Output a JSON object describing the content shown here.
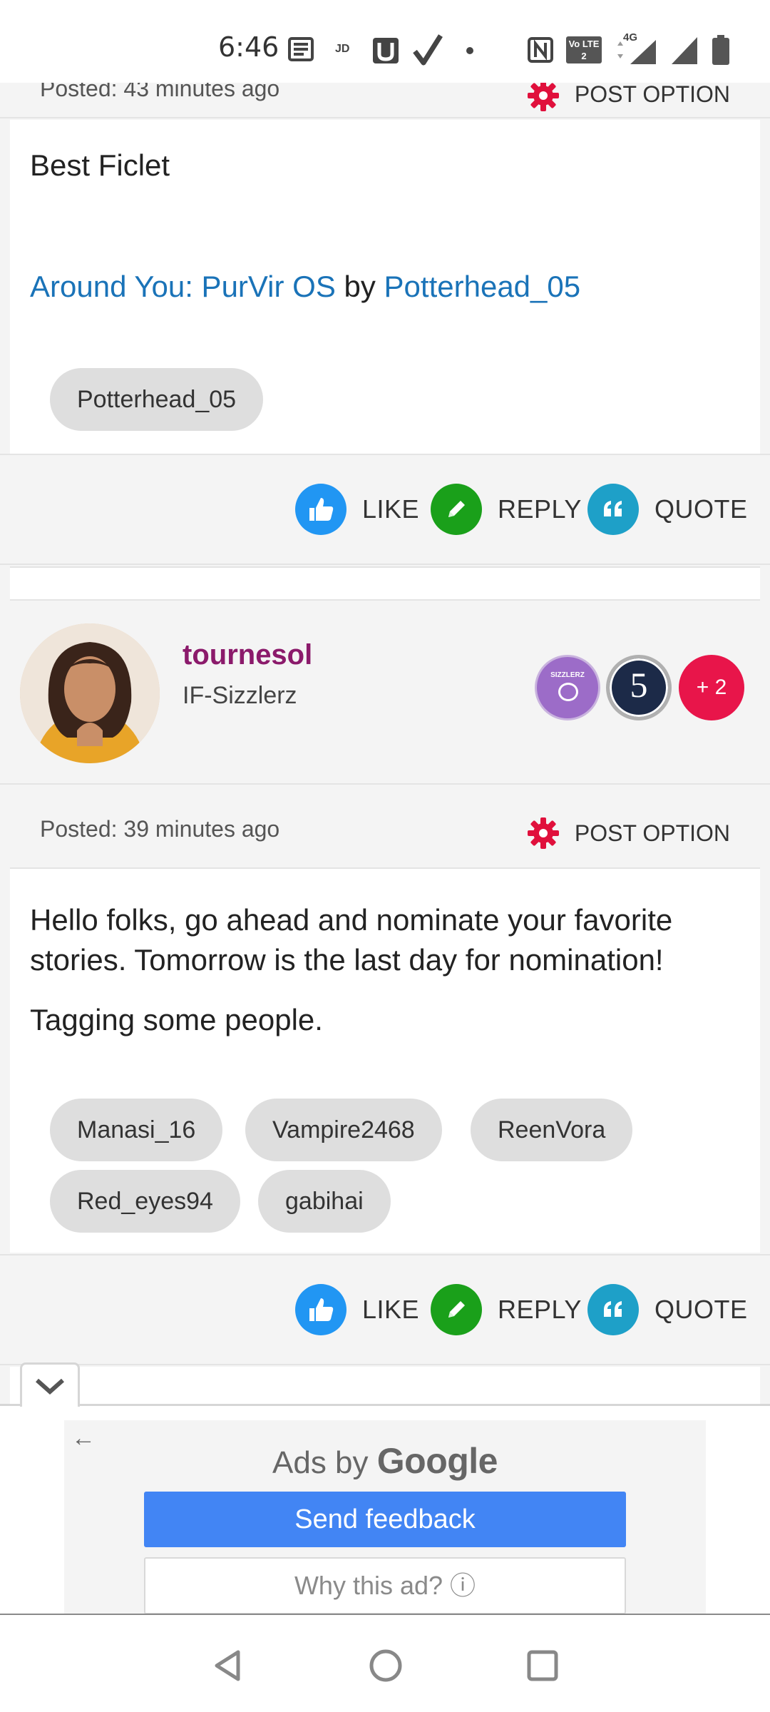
{
  "status_bar": {
    "time": "6:46",
    "icons": [
      "news-icon",
      "jd-icon",
      "u-app-icon",
      "check-icon",
      "dot-icon",
      "nfc-icon",
      "volte-icon",
      "4g-signal-icon",
      "signal-icon",
      "battery-icon"
    ],
    "labels": {
      "jd": "JD",
      "volte": "Vo LTE 2",
      "network": "4G"
    }
  },
  "previous_post": {
    "posted": "Posted: 43 minutes ago",
    "post_option": "POST OPTION",
    "heading": "Best Ficlet",
    "story_link": "Around You: PurVir OS",
    "by": "by",
    "author_link": "Potterhead_05",
    "tags": [
      "Potterhead_05"
    ]
  },
  "actions": {
    "like": "LIKE",
    "reply": "REPLY",
    "quote": "QUOTE"
  },
  "post": {
    "username": "tournesol",
    "user_title": "IF-Sizzlerz",
    "badge_sizzlerz": "SIZZLERZ",
    "badge_level": "5",
    "badge_more": "+ 2",
    "posted": "Posted: 39 minutes ago",
    "post_option": "POST OPTION",
    "paragraph1": "Hello folks, go ahead and nominate your favorite stories. Tomorrow is the last day for nomination!",
    "paragraph2": "Tagging some people.",
    "tags": [
      "Manasi_16",
      "Vampire2468",
      "ReenVora",
      "Red_eyes94",
      "gabihai"
    ]
  },
  "ad": {
    "ads_by": "Ads by",
    "google": "Google",
    "send_feedback": "Send feedback",
    "why_this_ad": "Why this ad? ⓘ"
  },
  "colors": {
    "link": "#1a73b8",
    "username": "#8b1a6b",
    "like_icon": "#2196f3",
    "reply_icon": "#1aa01a",
    "quote_icon": "#1ea0c8",
    "gear_icon": "#e0103c",
    "send_feedback": "#4285f4"
  }
}
